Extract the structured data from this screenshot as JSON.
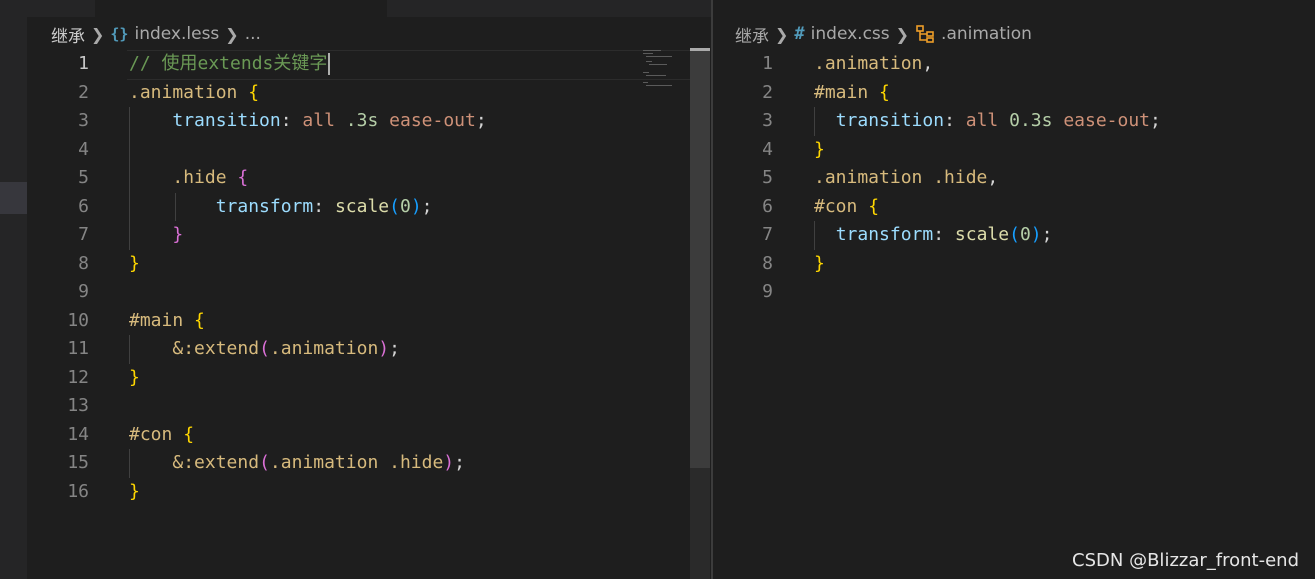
{
  "left_editor": {
    "breadcrumb": {
      "folder": "继承",
      "file": "index.less",
      "more": "..."
    },
    "icons": {
      "file": "braces-icon",
      "chevron": "chevron-right-icon"
    },
    "current_line": 1,
    "lines": [
      {
        "n": "1",
        "tokens": [
          {
            "c": "c-comment",
            "t": "// 使用extends关键字"
          }
        ],
        "cursor": true
      },
      {
        "n": "2",
        "tokens": [
          {
            "c": "c-sel",
            "t": ".animation "
          },
          {
            "c": "c-brace1",
            "t": "{"
          }
        ]
      },
      {
        "n": "3",
        "tokens": [
          {
            "c": "c-punct",
            "t": "    "
          },
          {
            "c": "c-prop",
            "t": "transition"
          },
          {
            "c": "c-punct",
            "t": ": "
          },
          {
            "c": "c-val",
            "t": "all"
          },
          {
            "c": "c-punct",
            "t": " "
          },
          {
            "c": "c-num",
            "t": ".3s"
          },
          {
            "c": "c-punct",
            "t": " "
          },
          {
            "c": "c-val",
            "t": "ease-out"
          },
          {
            "c": "c-punct",
            "t": ";"
          }
        ]
      },
      {
        "n": "4",
        "tokens": []
      },
      {
        "n": "5",
        "tokens": [
          {
            "c": "c-punct",
            "t": "    "
          },
          {
            "c": "c-sel",
            "t": ".hide "
          },
          {
            "c": "c-brace2",
            "t": "{"
          }
        ]
      },
      {
        "n": "6",
        "tokens": [
          {
            "c": "c-punct",
            "t": "        "
          },
          {
            "c": "c-prop",
            "t": "transform"
          },
          {
            "c": "c-punct",
            "t": ": "
          },
          {
            "c": "c-func",
            "t": "scale"
          },
          {
            "c": "c-paren",
            "t": "("
          },
          {
            "c": "c-num",
            "t": "0"
          },
          {
            "c": "c-paren",
            "t": ")"
          },
          {
            "c": "c-punct",
            "t": ";"
          }
        ]
      },
      {
        "n": "7",
        "tokens": [
          {
            "c": "c-punct",
            "t": "    "
          },
          {
            "c": "c-brace2",
            "t": "}"
          }
        ]
      },
      {
        "n": "8",
        "tokens": [
          {
            "c": "c-brace1",
            "t": "}"
          }
        ]
      },
      {
        "n": "9",
        "tokens": []
      },
      {
        "n": "10",
        "tokens": [
          {
            "c": "c-sel",
            "t": "#main "
          },
          {
            "c": "c-brace1",
            "t": "{"
          }
        ]
      },
      {
        "n": "11",
        "tokens": [
          {
            "c": "c-punct",
            "t": "    "
          },
          {
            "c": "c-sel",
            "t": "&:extend"
          },
          {
            "c": "c-brace2",
            "t": "("
          },
          {
            "c": "c-sel",
            "t": ".animation"
          },
          {
            "c": "c-brace2",
            "t": ")"
          },
          {
            "c": "c-punct",
            "t": ";"
          }
        ]
      },
      {
        "n": "12",
        "tokens": [
          {
            "c": "c-brace1",
            "t": "}"
          }
        ]
      },
      {
        "n": "13",
        "tokens": []
      },
      {
        "n": "14",
        "tokens": [
          {
            "c": "c-sel",
            "t": "#con "
          },
          {
            "c": "c-brace1",
            "t": "{"
          }
        ]
      },
      {
        "n": "15",
        "tokens": [
          {
            "c": "c-punct",
            "t": "    "
          },
          {
            "c": "c-sel",
            "t": "&:extend"
          },
          {
            "c": "c-brace2",
            "t": "("
          },
          {
            "c": "c-sel",
            "t": ".animation .hide"
          },
          {
            "c": "c-brace2",
            "t": ")"
          },
          {
            "c": "c-punct",
            "t": ";"
          }
        ]
      },
      {
        "n": "16",
        "tokens": [
          {
            "c": "c-brace1",
            "t": "}"
          }
        ]
      }
    ]
  },
  "right_editor": {
    "breadcrumb": {
      "folder": "继承",
      "file": "index.css",
      "symbol": ".animation"
    },
    "icons": {
      "file": "hash-icon",
      "symbol": "symbol-class-icon",
      "chevron": "chevron-right-icon"
    },
    "lines": [
      {
        "n": "1",
        "tokens": [
          {
            "c": "c-sel",
            "t": ".animation"
          },
          {
            "c": "c-punct",
            "t": ","
          }
        ]
      },
      {
        "n": "2",
        "tokens": [
          {
            "c": "c-sel",
            "t": "#main "
          },
          {
            "c": "c-brace1",
            "t": "{"
          }
        ]
      },
      {
        "n": "3",
        "tokens": [
          {
            "c": "c-punct",
            "t": "  "
          },
          {
            "c": "c-prop",
            "t": "transition"
          },
          {
            "c": "c-punct",
            "t": ": "
          },
          {
            "c": "c-val",
            "t": "all"
          },
          {
            "c": "c-punct",
            "t": " "
          },
          {
            "c": "c-num",
            "t": "0.3s"
          },
          {
            "c": "c-punct",
            "t": " "
          },
          {
            "c": "c-val",
            "t": "ease-out"
          },
          {
            "c": "c-punct",
            "t": ";"
          }
        ]
      },
      {
        "n": "4",
        "tokens": [
          {
            "c": "c-brace1",
            "t": "}"
          }
        ]
      },
      {
        "n": "5",
        "tokens": [
          {
            "c": "c-sel",
            "t": ".animation .hide"
          },
          {
            "c": "c-punct",
            "t": ","
          }
        ]
      },
      {
        "n": "6",
        "tokens": [
          {
            "c": "c-sel",
            "t": "#con "
          },
          {
            "c": "c-brace1",
            "t": "{"
          }
        ]
      },
      {
        "n": "7",
        "tokens": [
          {
            "c": "c-punct",
            "t": "  "
          },
          {
            "c": "c-prop",
            "t": "transform"
          },
          {
            "c": "c-punct",
            "t": ": "
          },
          {
            "c": "c-func",
            "t": "scale"
          },
          {
            "c": "c-paren",
            "t": "("
          },
          {
            "c": "c-num",
            "t": "0"
          },
          {
            "c": "c-paren",
            "t": ")"
          },
          {
            "c": "c-punct",
            "t": ";"
          }
        ]
      },
      {
        "n": "8",
        "tokens": [
          {
            "c": "c-brace1",
            "t": "}"
          }
        ]
      },
      {
        "n": "9",
        "tokens": []
      }
    ]
  },
  "watermark": "CSDN @Blizzar_front-end",
  "colors": {
    "background": "#1e1e1e",
    "selector": "#d7ba7d",
    "property": "#9cdcfe",
    "value": "#ce9178",
    "number": "#b5cea8",
    "comment": "#6a9955",
    "bracket_level1": "#ffd700",
    "bracket_level2": "#da70d6",
    "bracket_level3": "#179fff",
    "function": "#dcdcaa"
  }
}
